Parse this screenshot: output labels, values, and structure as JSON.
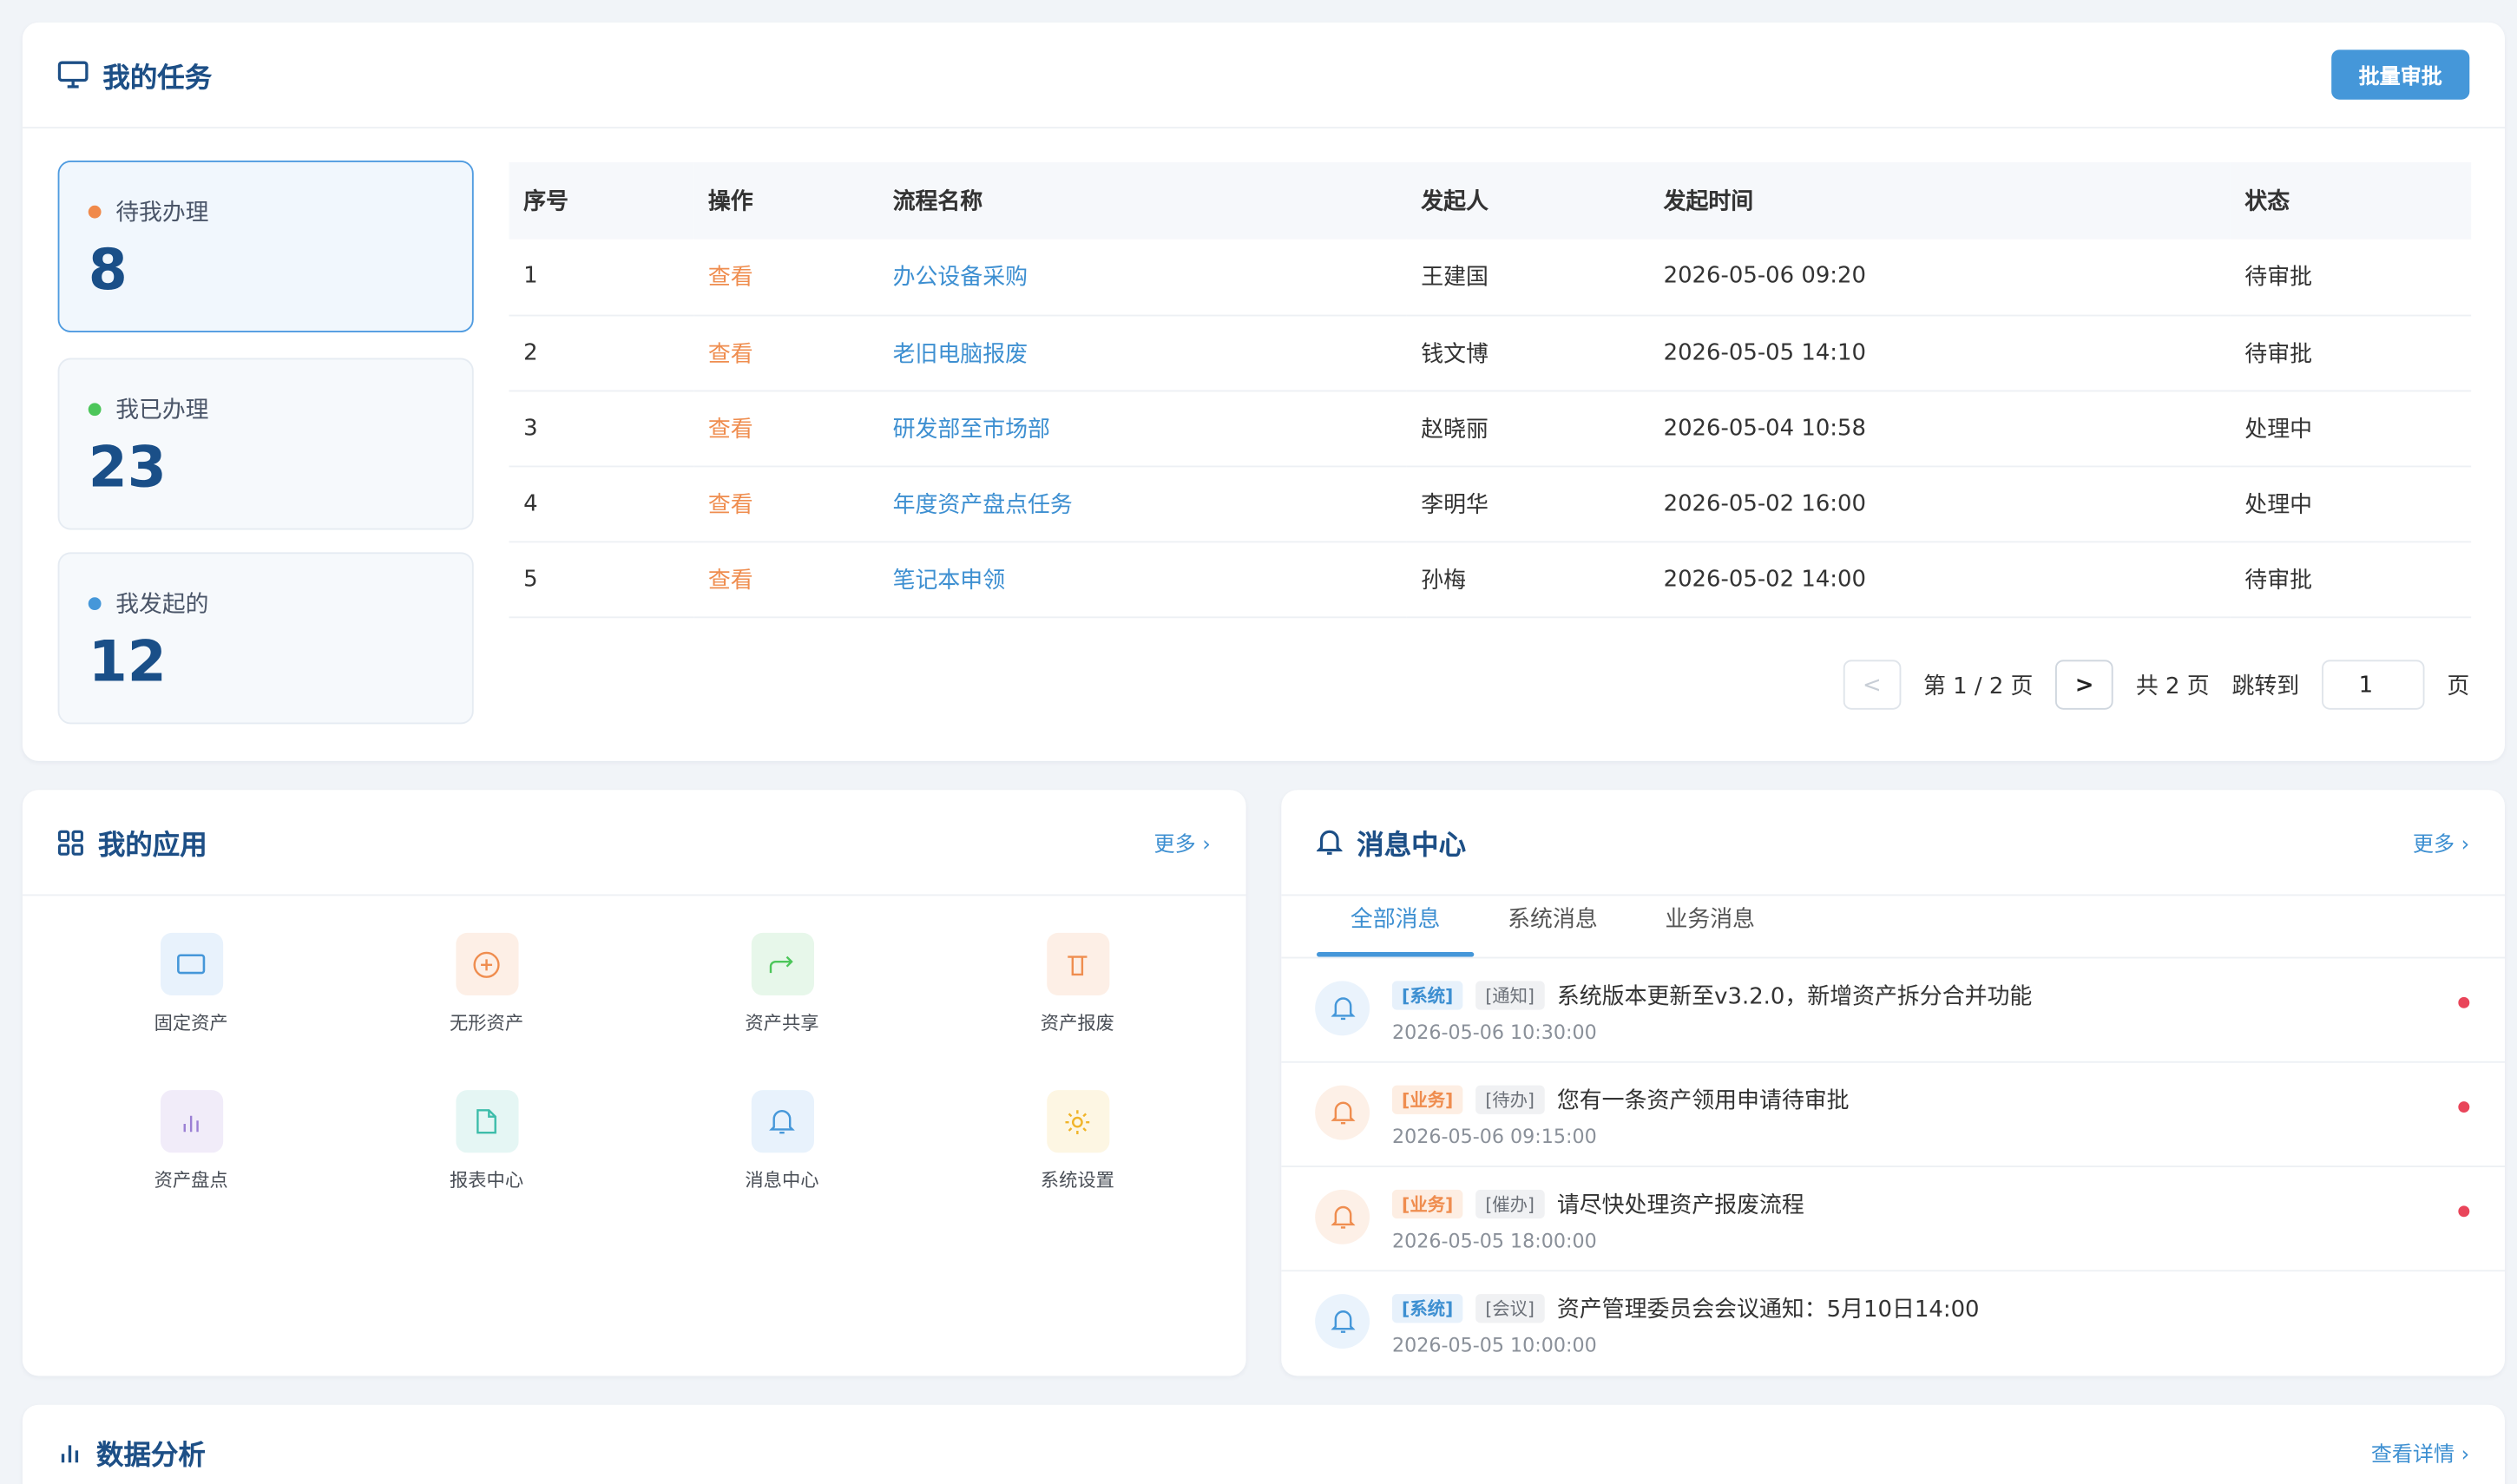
{
  "tasks": {
    "title": "我的任务",
    "batch_button": "批量审批",
    "stats": [
      {
        "label": "待我办理",
        "value": "8",
        "color": "#f08a4b"
      },
      {
        "label": "我已办理",
        "value": "23",
        "color": "#4cc65a"
      },
      {
        "label": "我发起的",
        "value": "12",
        "color": "#4597d9"
      }
    ],
    "columns": [
      "序号",
      "操作",
      "流程名称",
      "发起人",
      "发起时间",
      "状态"
    ],
    "rows": [
      {
        "no": "1",
        "action": "查看",
        "name": "办公设备采购",
        "initiator": "王建国",
        "time": "2026-05-06 09:20",
        "status": "待审批"
      },
      {
        "no": "2",
        "action": "查看",
        "name": "老旧电脑报废",
        "initiator": "钱文博",
        "time": "2026-05-05 14:10",
        "status": "待审批"
      },
      {
        "no": "3",
        "action": "查看",
        "name": "研发部至市场部",
        "initiator": "赵晓丽",
        "time": "2026-05-04 10:58",
        "status": "处理中"
      },
      {
        "no": "4",
        "action": "查看",
        "name": "年度资产盘点任务",
        "initiator": "李明华",
        "time": "2026-05-02 16:00",
        "status": "处理中"
      },
      {
        "no": "5",
        "action": "查看",
        "name": "笔记本申领",
        "initiator": "孙梅",
        "time": "2026-05-02 14:00",
        "status": "待审批"
      }
    ],
    "pagination": {
      "prev": "<",
      "page_info": "第 1 / 2 页",
      "next": ">",
      "total": "共 2 页",
      "jump_label": "跳转到",
      "jump_value": "1",
      "page_suffix": "页"
    }
  },
  "apps": {
    "title": "我的应用",
    "more": "更多 ›",
    "items": [
      {
        "label": "固定资产",
        "icon": "monitor-icon",
        "bg": "#e8f2fc",
        "fg": "#4597d9"
      },
      {
        "label": "无形资产",
        "icon": "plus-circle-icon",
        "bg": "#fdefe6",
        "fg": "#ef8d4f"
      },
      {
        "label": "资产共享",
        "icon": "share-arrow-icon",
        "bg": "#e7f7ea",
        "fg": "#4cc65a"
      },
      {
        "label": "资产报废",
        "icon": "trash-icon",
        "bg": "#fdefe6",
        "fg": "#ef8d4f"
      },
      {
        "label": "资产盘点",
        "icon": "bar-chart-icon",
        "bg": "#f1ecf9",
        "fg": "#9b7fd4"
      },
      {
        "label": "报表中心",
        "icon": "document-icon",
        "bg": "#e5f6f4",
        "fg": "#3dbdaa"
      },
      {
        "label": "消息中心",
        "icon": "bell-icon",
        "bg": "#e8f2fc",
        "fg": "#4597d9"
      },
      {
        "label": "系统设置",
        "icon": "gear-icon",
        "bg": "#fdf6e3",
        "fg": "#f0b429"
      }
    ]
  },
  "messages": {
    "title": "消息中心",
    "more": "更多 ›",
    "tabs": [
      "全部消息",
      "系统消息",
      "业务消息"
    ],
    "items": [
      {
        "tag": "[系统]",
        "type": "sys",
        "sub": "[通知]",
        "text": "系统版本更新至v3.2.0，新增资产拆分合并功能",
        "time": "2026-05-06 10:30:00",
        "unread": true
      },
      {
        "tag": "[业务]",
        "type": "biz",
        "sub": "[待办]",
        "text": "您有一条资产领用申请待审批",
        "time": "2026-05-06 09:15:00",
        "unread": true
      },
      {
        "tag": "[业务]",
        "type": "biz",
        "sub": "[催办]",
        "text": "请尽快处理资产报废流程",
        "time": "2026-05-05 18:00:00",
        "unread": true
      },
      {
        "tag": "[系统]",
        "type": "sys",
        "sub": "[会议]",
        "text": "资产管理委员会会议通知：5月10日14:00",
        "time": "2026-05-05 10:00:00",
        "unread": false
      }
    ]
  },
  "analysis": {
    "title": "数据分析",
    "more": "查看详情 ›"
  }
}
